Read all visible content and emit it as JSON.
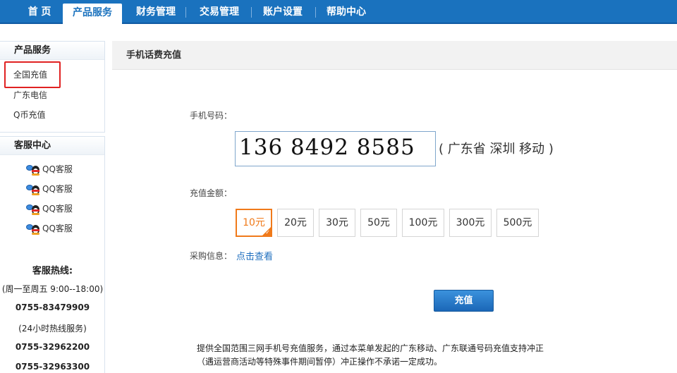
{
  "nav": {
    "items": [
      {
        "label": "首 页"
      },
      {
        "label": "产品服务"
      },
      {
        "label": "财务管理"
      },
      {
        "label": "交易管理"
      },
      {
        "label": "账户设置"
      },
      {
        "label": "帮助中心"
      }
    ],
    "active_color": "#1a72be"
  },
  "sidebar": {
    "product": {
      "title": "产品服务",
      "items": [
        {
          "label": "全国充值"
        },
        {
          "label": "广东电信"
        },
        {
          "label": "Q币充值"
        }
      ]
    },
    "service": {
      "title": "客服中心",
      "qq": [
        {
          "label": "QQ客服",
          "icon": "qq-icon"
        },
        {
          "label": "QQ客服",
          "icon": "qq-icon"
        },
        {
          "label": "QQ客服",
          "icon": "qq-icon"
        },
        {
          "label": "QQ客服",
          "icon": "qq-icon"
        }
      ],
      "hotline_title": "客服热线:",
      "hours": "(周一至周五 9:00--18:00)",
      "phone1": "0755-83479909",
      "hours24": "(24小时热线服务)",
      "phone2": "0755-32962200",
      "phone3": "0755-32963300"
    }
  },
  "main": {
    "title": "手机话费充值",
    "phone_label": "手机号码：",
    "phone_value": "136  8492  8585",
    "location": "( 广东省 深圳 移动 )",
    "amount_label": "充值金额：",
    "amounts": [
      "10元",
      "20元",
      "30元",
      "50元",
      "100元",
      "300元",
      "500元"
    ],
    "selected_amount": "10元",
    "purchase_label": "采购信息：",
    "purchase_link": "点击查看",
    "submit_label": "充值",
    "notice_line1": "提供全国范围三网手机号充值服务，通过本菜单发起的广东移动、广东联通号码充值支持冲正",
    "notice_line2": "（遇运营商活动等特殊事件期间暂停）冲正操作不承诺一定成功。"
  },
  "colors": {
    "brand_blue": "#1a72be",
    "selected_orange": "#f07a1a",
    "highlight_red": "#e02222",
    "link_blue": "#1f6fbf"
  }
}
